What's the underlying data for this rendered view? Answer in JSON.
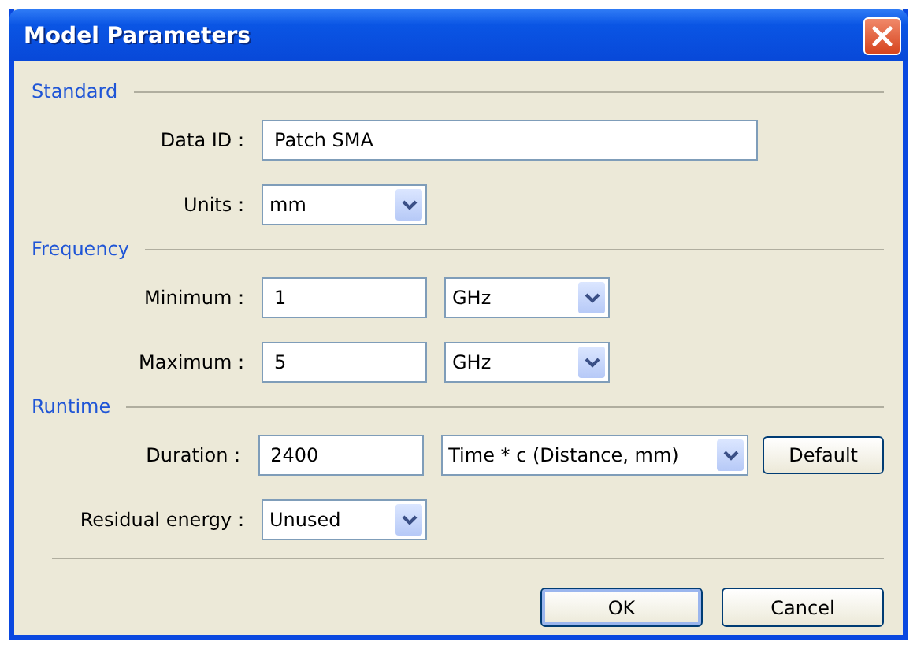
{
  "window": {
    "title": "Model Parameters"
  },
  "sections": [
    {
      "title": "Standard",
      "rows": [
        {
          "label": "Data ID :",
          "controls": [
            {
              "kind": "text",
              "value": "Patch SMA"
            }
          ]
        },
        {
          "label": "Units :",
          "controls": [
            {
              "kind": "select",
              "value": "mm"
            }
          ]
        }
      ]
    },
    {
      "title": "Frequency",
      "rows": [
        {
          "label": "Minimum :",
          "controls": [
            {
              "kind": "text",
              "value": "1"
            },
            {
              "kind": "select",
              "value": "GHz"
            }
          ]
        },
        {
          "label": "Maximum :",
          "controls": [
            {
              "kind": "text",
              "value": "5"
            },
            {
              "kind": "select",
              "value": "GHz"
            }
          ]
        }
      ]
    },
    {
      "title": "Runtime",
      "rows": [
        {
          "label": "Duration :",
          "controls": [
            {
              "kind": "text",
              "value": "2400"
            },
            {
              "kind": "select",
              "value": "Time * c (Distance, mm)"
            },
            {
              "kind": "button",
              "value": "Default"
            }
          ]
        },
        {
          "label": "Residual energy :",
          "controls": [
            {
              "kind": "select",
              "value": "Unused"
            }
          ]
        }
      ]
    }
  ],
  "buttons": [
    {
      "label": "OK",
      "default": true
    },
    {
      "label": "Cancel",
      "default": false
    }
  ]
}
